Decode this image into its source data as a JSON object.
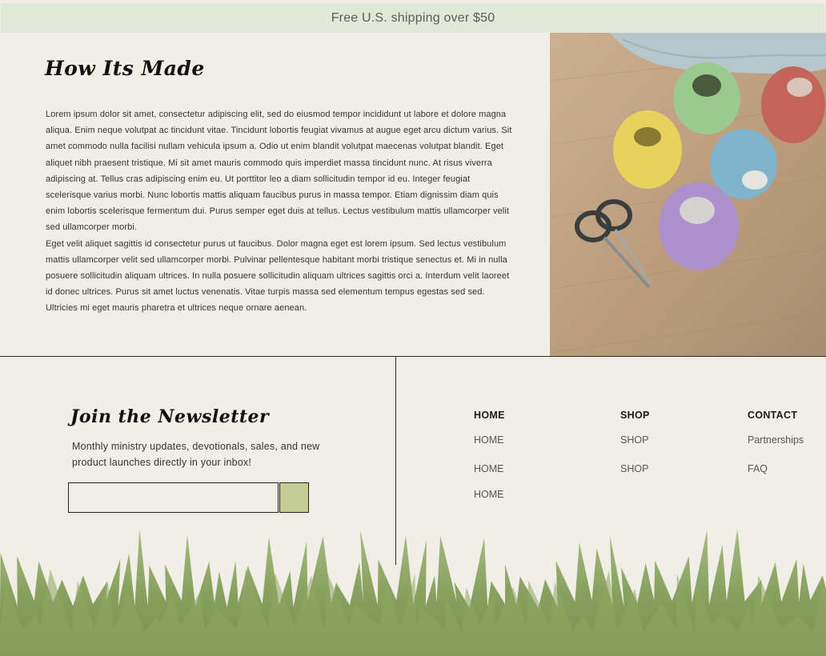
{
  "banner": {
    "text": "Free U.S. shipping over $50"
  },
  "how_its_made": {
    "title": "How Its Made",
    "paragraph_1": "Lorem ipsum dolor sit amet, consectetur adipiscing elit, sed do eiusmod tempor incididunt ut labore et dolore magna aliqua. Enim neque volutpat ac tincidunt vitae. Tincidunt lobortis feugiat vivamus at augue eget arcu dictum varius. Sit amet commodo nulla facilisi nullam vehicula ipsum a. Odio ut enim blandit volutpat maecenas volutpat blandit. Eget aliquet nibh praesent tristique. Mi sit amet mauris commodo quis imperdiet massa tincidunt nunc. At risus viverra adipiscing at. Tellus cras adipiscing enim eu. Ut porttitor leo a diam sollicitudin tempor id eu. Integer feugiat scelerisque varius morbi. Nunc lobortis mattis aliquam faucibus purus in massa tempor. Etiam dignissim diam quis enim lobortis scelerisque fermentum dui. Purus semper eget duis at tellus. Lectus vestibulum mattis ullamcorper velit sed ullamcorper morbi.",
    "paragraph_2": "Eget velit aliquet sagittis id consectetur purus ut faucibus. Dolor magna eget est lorem ipsum. Sed lectus vestibulum mattis ullamcorper velit sed ullamcorper morbi. Pulvinar pellentesque habitant morbi tristique senectus et. Mi in nulla posuere sollicitudin aliquam ultrices. In nulla posuere sollicitudin aliquam ultrices sagittis orci a. Interdum velit laoreet id donec ultrices. Purus sit amet luctus venenatis. Vitae turpis massa sed elementum tempus egestas sed sed. Ultricies mi eget mauris pharetra et ultrices neque ornare aenean."
  },
  "newsletter": {
    "title": "Join the Newsletter",
    "description": "Monthly ministry updates, devotionals, sales, and new product launches directly in your inbox!",
    "email_value": "",
    "submit_label": ""
  },
  "footer_nav": {
    "home": {
      "heading": "HOME",
      "links": [
        "HOME",
        "HOME",
        "HOME"
      ]
    },
    "shop": {
      "heading": "SHOP",
      "links": [
        "SHOP",
        "SHOP"
      ]
    },
    "contact": {
      "heading": "CONTACT",
      "links": [
        "Partnerships",
        "FAQ"
      ]
    }
  },
  "colors": {
    "background": "#f0eee6",
    "banner": "#e1e8d5",
    "submit_button": "#c2cb91",
    "grass": "#7e9a4e"
  },
  "images": {
    "yarn_photo": "yarn-balls-and-scissors",
    "grass_border": "watercolor-grass"
  }
}
